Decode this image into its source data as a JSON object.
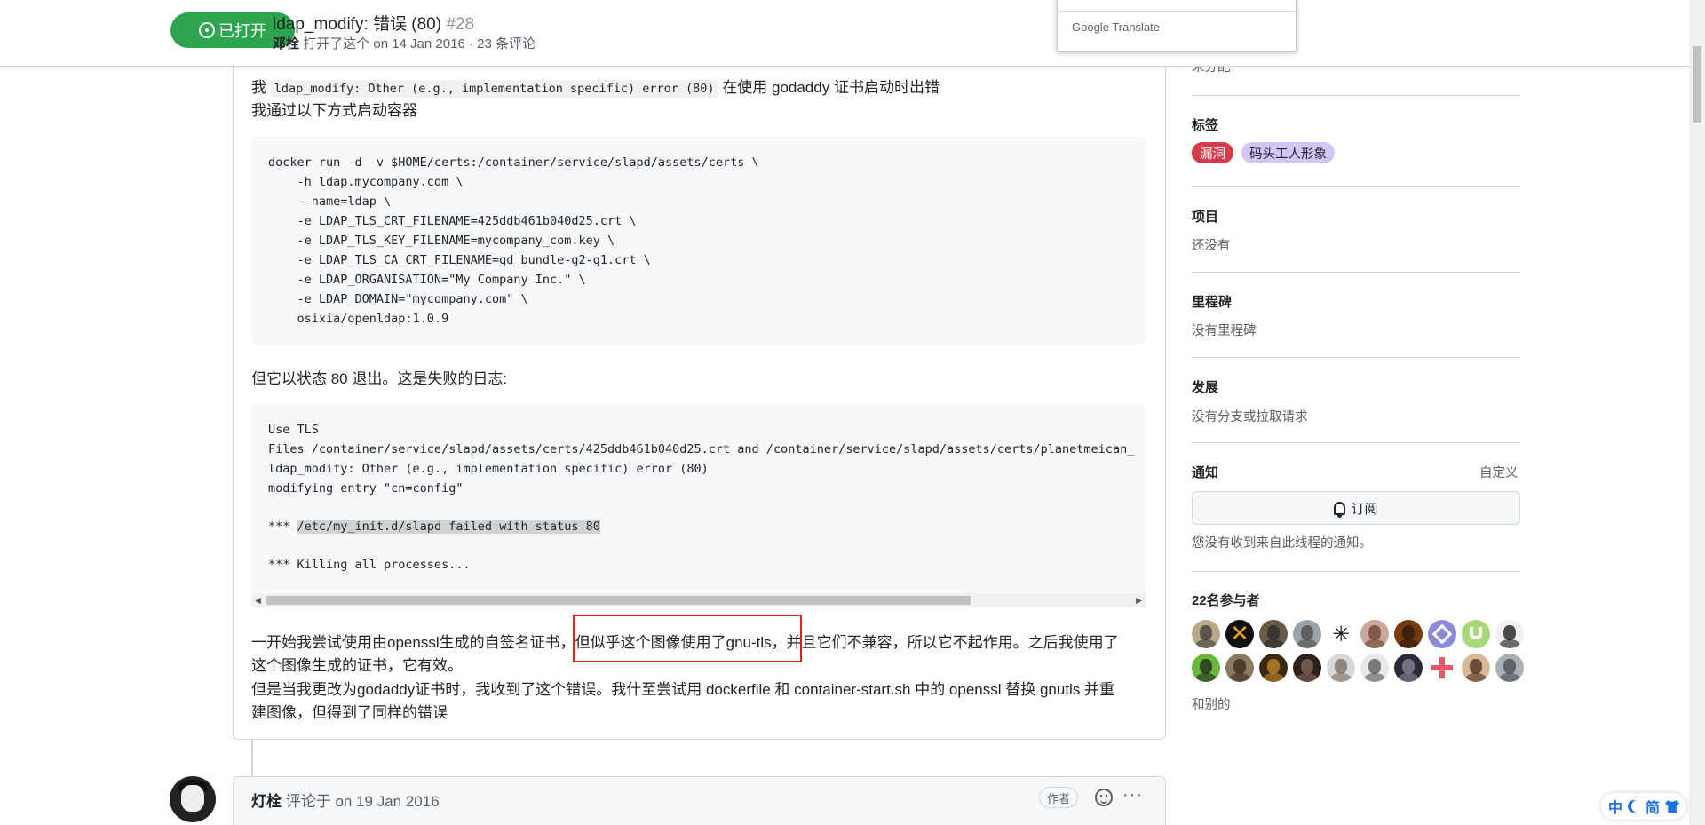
{
  "header": {
    "state_label": "已打开",
    "title": "ldap_modify: 错误 (80)",
    "number": "#28",
    "author": "邓栓",
    "meta": "打开了这个 on 14 Jan 2016 · 23 条评论"
  },
  "translate_popup": {
    "google": "Google",
    "translate": "Translate"
  },
  "comment": {
    "line1_prefix": "我",
    "line1_code": "ldap_modify: Other (e.g., implementation specific) error (80)",
    "line1_suffix": "在使用 godaddy 证书启动时出错",
    "line2": "我通过以下方式启动容器",
    "code1": [
      "docker run -d -v $HOME/certs:/container/service/slapd/assets/certs \\",
      "    -h ldap.mycompany.com \\",
      "    --name=ldap \\",
      "    -e LDAP_TLS_CRT_FILENAME=425ddb461b040d25.crt \\",
      "    -e LDAP_TLS_KEY_FILENAME=mycompany_com.key \\",
      "    -e LDAP_TLS_CA_CRT_FILENAME=gd_bundle-g2-g1.crt \\",
      "    -e LDAP_ORGANISATION=\"My Company Inc.\" \\",
      "    -e LDAP_DOMAIN=\"mycompany.com\" \\",
      "    osixia/openldap:1.0.9"
    ],
    "line3": "但它以状态 80 退出。这是失败的日志:",
    "code2": [
      "Use TLS",
      "Files /container/service/slapd/assets/certs/425ddb461b040d25.crt and /container/service/slapd/assets/certs/planetmeican_",
      "ldap_modify: Other (e.g., implementation specific) error (80)",
      "modifying entry \"cn=config\""
    ],
    "code2_fail_prefix": "*** ",
    "code2_fail_highlight": "/etc/my_init.d/slapd failed with status 80",
    "code2_kill": "*** Killing all processes...",
    "para1_a": "一开始我尝试使用由openssl生成的自签名证书，",
    "para1_b": "但似乎这个图像使用了gnu-tls，",
    "para1_c": "并且它们不兼容，所以它不起作用。之后我使用了",
    "para1_line2": "这个图像生成的证书，它有效。",
    "para2_line1": "但是当我更改为godaddy证书时，我收到了这个错误。我什至尝试用 dockerfile 和 container-start.sh 中的 openssl 替换 gnutls 并重",
    "para2_line2": "建图像，但得到了同样的错误"
  },
  "comment2": {
    "author": "灯栓",
    "action": "评论于 on 19 Jan 2016",
    "badge": "作者",
    "more": "···"
  },
  "sidebar": {
    "assignees_text": "未分配",
    "labels_head": "标签",
    "labels": [
      "漏洞",
      "码头工人形象"
    ],
    "projects_head": "项目",
    "projects_text": "还没有",
    "milestone_head": "里程碑",
    "milestone_text": "没有里程碑",
    "development_head": "发展",
    "development_text": "没有分支或拉取请求",
    "notifications_head": "通知",
    "customize": "自定义",
    "subscribe": "订阅",
    "notify_text": "您没有收到来自此线程的通知。",
    "participants_head": "22名参与者",
    "others": "和别的"
  },
  "corner_widget": {
    "zh": "中",
    "simplified": "简"
  },
  "colors": {
    "open_green": "#2da44e",
    "bug_label": "#d73a4a",
    "docker_label": "#d4c5f9",
    "highlight_red": "#e0201f"
  },
  "participant_avatars": [
    {
      "bg": "#b8a98a",
      "fg": "#3a3a3a",
      "kind": "face"
    },
    {
      "bg": "#111111",
      "fg": "#e8a020",
      "kind": "x"
    },
    {
      "bg": "#6b5a48",
      "fg": "#2a2a2a",
      "kind": "face"
    },
    {
      "bg": "#9aa4ad",
      "fg": "#4a4a4a",
      "kind": "face"
    },
    {
      "bg": "#ffffff",
      "fg": "#111111",
      "kind": "star"
    },
    {
      "bg": "#c7a89a",
      "fg": "#6a4030",
      "kind": "face"
    },
    {
      "bg": "#7a3a10",
      "fg": "#2a1a0a",
      "kind": "face"
    },
    {
      "bg": "#8a8ad8",
      "fg": "#ffffff",
      "kind": "geo"
    },
    {
      "bg": "#a8d878",
      "fg": "#ffffff",
      "kind": "u"
    },
    {
      "bg": "#f0f0f0",
      "fg": "#111111",
      "kind": "face"
    },
    {
      "bg": "#6ab83a",
      "fg": "#222222",
      "kind": "face"
    },
    {
      "bg": "#8a7a60",
      "fg": "#3a2a1a",
      "kind": "face"
    },
    {
      "bg": "#3a2a10",
      "fg": "#c88a2a",
      "kind": "face"
    },
    {
      "bg": "#2a2020",
      "fg": "#8a6a5a",
      "kind": "face"
    },
    {
      "bg": "#d8d8d8",
      "fg": "#7a6a5a",
      "kind": "face"
    },
    {
      "bg": "#e8e8e8",
      "fg": "#555555",
      "kind": "face"
    },
    {
      "bg": "#2a2a3a",
      "fg": "#8a8a9a",
      "kind": "face"
    },
    {
      "bg": "#ffffff",
      "fg": "#e05a6a",
      "kind": "plus"
    },
    {
      "bg": "#d8b898",
      "fg": "#4a2a1a",
      "kind": "face"
    },
    {
      "bg": "#a8b0b8",
      "fg": "#4a4a4a",
      "kind": "face"
    }
  ]
}
